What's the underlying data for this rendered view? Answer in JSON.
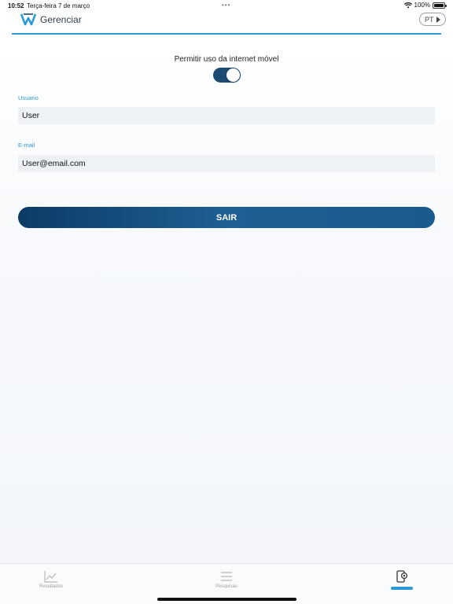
{
  "status_bar": {
    "time": "10:52",
    "date": "Terça-feira 7 de março",
    "dots": "•••",
    "battery": "100%"
  },
  "header": {
    "title": "Gerenciar",
    "language": "PT",
    "accent_color": "#2c9ad6"
  },
  "settings": {
    "mobile_data_label": "Permitir uso da internet móvel",
    "mobile_data_enabled": true
  },
  "fields": {
    "username_label": "Usuario",
    "username_value": "User",
    "email_label": "E-mail",
    "email_value": "User@email.com"
  },
  "actions": {
    "logout_label": "SAIR"
  },
  "tabs": [
    {
      "label": "Resultados",
      "icon": "line-chart-icon"
    },
    {
      "label": "Pesquisas",
      "icon": "list-icon"
    },
    {
      "label": "",
      "icon": "device-settings-icon",
      "active": true
    }
  ]
}
